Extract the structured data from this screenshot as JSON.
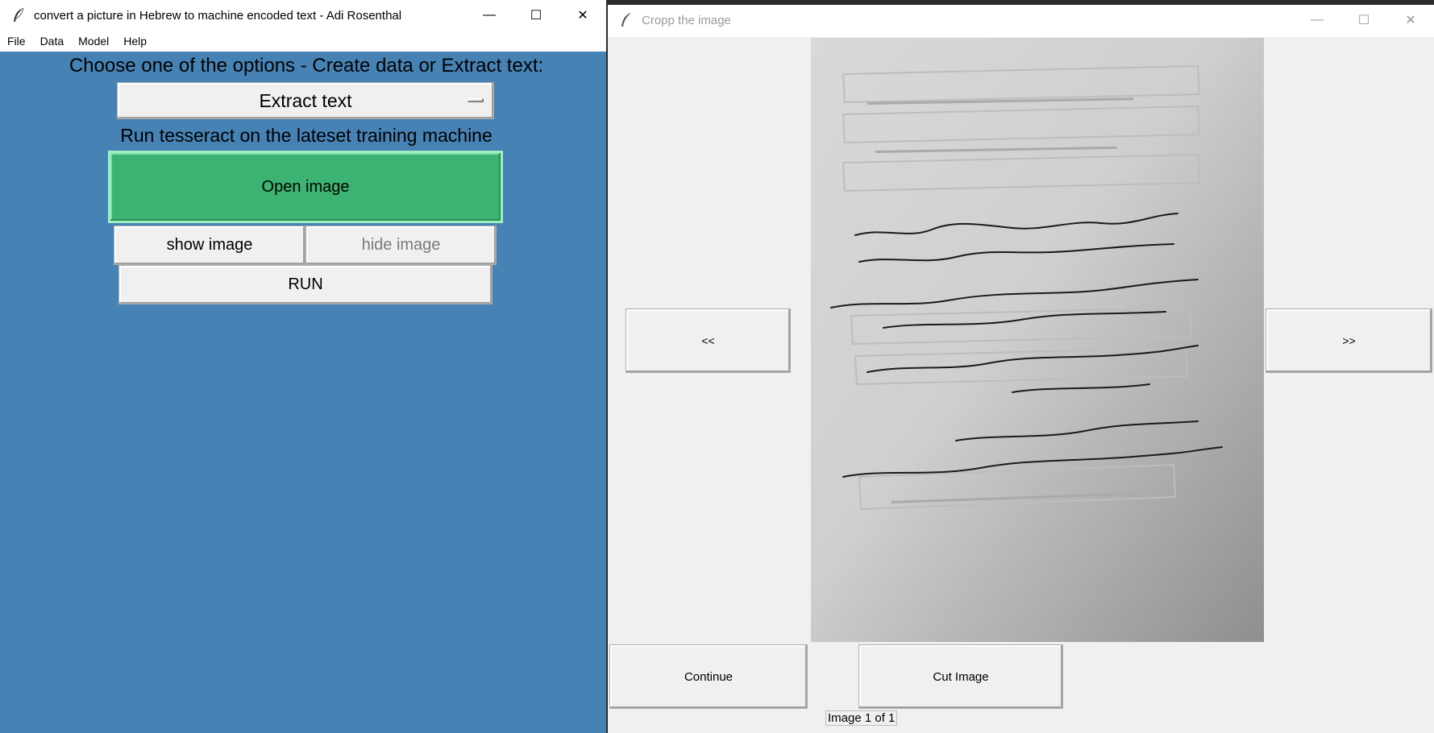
{
  "left_window": {
    "title": "convert a picture in Hebrew to machine encoded text - Adi Rosenthal",
    "menu": [
      "File",
      "Data",
      "Model",
      "Help"
    ],
    "heading": "Choose one of the options - Create data or Extract text:",
    "option_selected": "Extract text",
    "description": "Run tesseract on the lateset training machine",
    "open_image_label": "Open image",
    "show_image_label": "show image",
    "hide_image_label": "hide image",
    "run_label": "RUN",
    "controls": {
      "minimize": "—",
      "maximize": "☐",
      "close": "✕"
    }
  },
  "right_window": {
    "title": "Cropp the image",
    "prev_label": "<<",
    "next_label": ">>",
    "continue_label": "Continue",
    "cut_label": "Cut Image",
    "status": "Image 1 of 1",
    "controls": {
      "minimize": "—",
      "maximize": "☐",
      "close": "✕"
    }
  },
  "colors": {
    "background_blue": "#4682b4",
    "open_button_green": "#3cb371"
  }
}
